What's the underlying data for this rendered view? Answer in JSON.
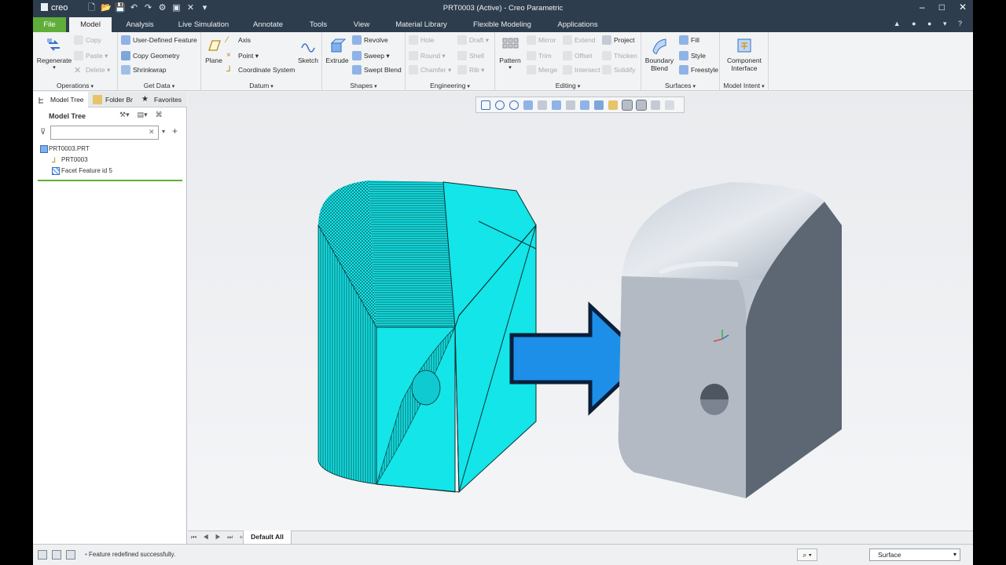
{
  "app": {
    "logo": "creo",
    "title": "PRT0003 (Active) - Creo Parametric",
    "window_controls": [
      "–",
      "□",
      "✕"
    ]
  },
  "tabs": [
    "File",
    "Model",
    "Analysis",
    "Live Simulation",
    "Annotate",
    "Tools",
    "View",
    "Material Library",
    "Flexible Modeling",
    "Applications"
  ],
  "active_tab": "Model",
  "ribbon": {
    "operations": {
      "label": "Operations",
      "regenerate": "Regenerate",
      "copy": "Copy",
      "paste": "Paste",
      "delete": "Delete"
    },
    "get_data": {
      "label": "Get Data",
      "user_defined_feature": "User-Defined Feature",
      "copy_geometry": "Copy Geometry",
      "shrinkwrap": "Shrinkwrap"
    },
    "datum": {
      "label": "Datum",
      "plane": "Plane",
      "axis": "Axis",
      "point": "Point",
      "coordinate_system": "Coordinate System",
      "sketch": "Sketch"
    },
    "shapes": {
      "label": "Shapes",
      "extrude": "Extrude",
      "revolve": "Revolve",
      "sweep": "Sweep",
      "swept_blend": "Swept Blend"
    },
    "engineering": {
      "label": "Engineering",
      "hole": "Hole",
      "round": "Round",
      "chamfer": "Chamfer",
      "draft": "Draft",
      "shell": "Shell",
      "rib": "Rib"
    },
    "editing": {
      "label": "Editing",
      "pattern": "Pattern",
      "mirror": "Mirror",
      "trim": "Trim",
      "merge": "Merge",
      "extend": "Extend",
      "offset": "Offset",
      "intersect": "Intersect",
      "project": "Project",
      "thicken": "Thicken",
      "solidify": "Solidify"
    },
    "surfaces": {
      "label": "Surfaces",
      "boundary_blend_1": "Boundary",
      "boundary_blend_2": "Blend",
      "fill": "Fill",
      "style": "Style",
      "freestyle": "Freestyle"
    },
    "model_intent": {
      "label": "Model Intent",
      "component_interface_1": "Component",
      "component_interface_2": "Interface"
    }
  },
  "panel": {
    "tabs": [
      "Model Tree",
      "Folder Br",
      "Favorites"
    ],
    "header": "Model Tree",
    "search_value": "",
    "tree": [
      {
        "label": "PRT0003.PRT",
        "icon": "part-icon"
      },
      {
        "label": "PRT0003",
        "icon": "csys-icon"
      },
      {
        "label": "Facet Feature id 5",
        "icon": "facet-icon"
      }
    ]
  },
  "view": {
    "tabs": [
      "Default All"
    ],
    "nav": "⏮ ◀ ▶ ⏭ +"
  },
  "status": {
    "message": "Feature redefined successfully.",
    "filter": "Surface"
  },
  "colors": {
    "title_bar": "#2e3d4e",
    "file_tab": "#5fae3a",
    "mesh_fill": "#13e5e8",
    "solid_fill": "#b9c1cc",
    "arrow_fill": "#1e8fe8"
  }
}
